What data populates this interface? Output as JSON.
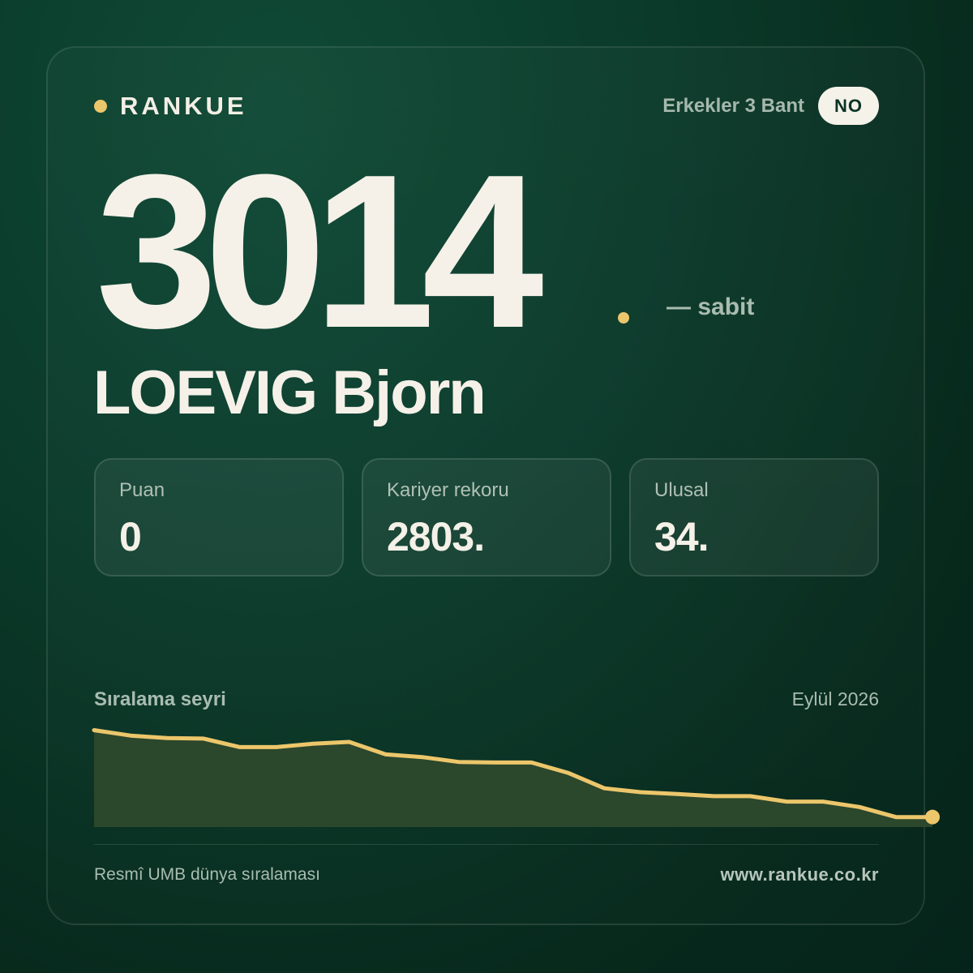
{
  "brand": {
    "name": "RANKUE"
  },
  "header": {
    "category": "Erkekler 3 Bant",
    "country": "NO"
  },
  "ranking": {
    "rank": "3014",
    "change": "— sabit"
  },
  "player": {
    "name": "LOEVIG Bjorn"
  },
  "stats": [
    {
      "label": "Puan",
      "value": "0"
    },
    {
      "label": "Kariyer rekoru",
      "value": "2803."
    },
    {
      "label": "Ulusal",
      "value": "34."
    }
  ],
  "chart": {
    "title": "Sıralama seyri",
    "date": "Eylül 2026"
  },
  "chart_data": {
    "type": "area",
    "title": "Sıralama seyri",
    "xlabel": "",
    "ylabel": "",
    "values": [
      2.0,
      3.8,
      4.6,
      4.8,
      7.6,
      7.6,
      6.5,
      5.9,
      10.0,
      10.9,
      12.5,
      12.7,
      12.7,
      16.1,
      21.2,
      22.5,
      23.1,
      23.8,
      23.8,
      25.6,
      25.6,
      27.4,
      30.7,
      30.7
    ],
    "ylim": [
      0,
      34
    ],
    "grid": false,
    "line_color": "#ecc66b",
    "fill_color": "#2b472c"
  },
  "footer": {
    "source": "Resmî UMB dünya sıralaması",
    "website": "www.rankue.co.kr"
  },
  "colors": {
    "accent": "#ecc66b",
    "background": "#0b3a2a",
    "text": "#f5f1e8"
  }
}
